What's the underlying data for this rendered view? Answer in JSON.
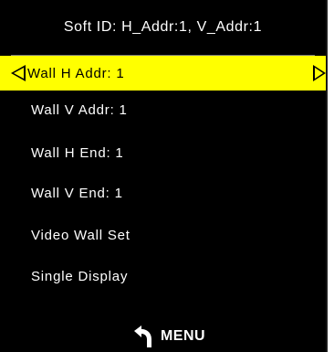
{
  "title": "Soft ID:  H_Addr:1, V_Addr:1",
  "menu": {
    "items": [
      {
        "label": "Wall H Addr: 1",
        "selected": true
      },
      {
        "label": "Wall V Addr: 1",
        "selected": false
      },
      {
        "label": "Wall H End: 1",
        "selected": false
      },
      {
        "label": "Wall V End: 1",
        "selected": false
      },
      {
        "label": "Video Wall Set",
        "selected": false
      },
      {
        "label": "Single Display",
        "selected": false
      }
    ]
  },
  "footer": {
    "icon": "back-arrow-icon",
    "label": "MENU"
  },
  "colors": {
    "background": "#000000",
    "highlight": "#ffff00",
    "text": "#ffffff",
    "highlight_text": "#000000"
  }
}
